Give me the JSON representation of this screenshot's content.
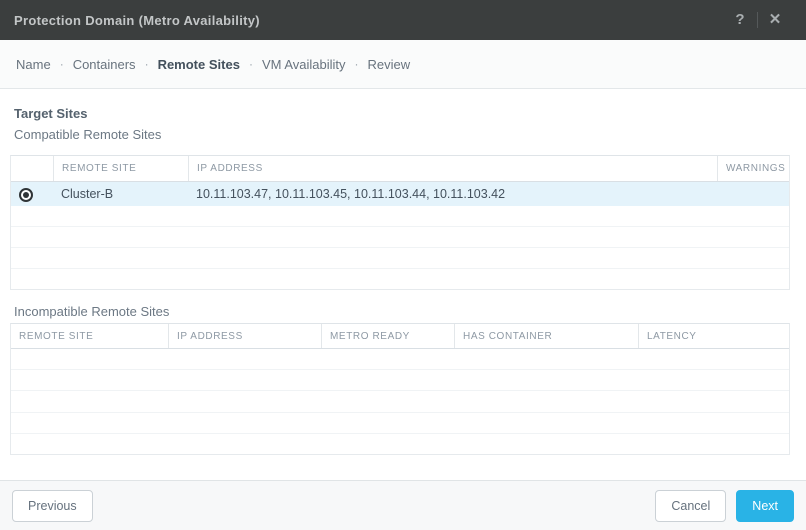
{
  "dialog": {
    "title": "Protection Domain (Metro Availability)"
  },
  "icons": {
    "help": "?",
    "close": "✕"
  },
  "steps": {
    "separator": "·",
    "active_step": "Remote Sites",
    "items": [
      {
        "label": "Name"
      },
      {
        "label": "Containers"
      },
      {
        "label": "Remote Sites"
      },
      {
        "label": "VM Availability"
      },
      {
        "label": "Review"
      }
    ]
  },
  "content": {
    "section_title": "Target Sites",
    "compatible": {
      "label": "Compatible Remote Sites",
      "columns": {
        "remote_site": "REMOTE SITE",
        "ip_address": "IP ADDRESS",
        "warnings": "WARNINGS"
      },
      "selected_row": {
        "remote_site": "Cluster-B",
        "ip_address": "10.11.103.47, 10.11.103.45, 10.11.103.44, 10.11.103.42",
        "warnings": "",
        "selected": true
      }
    },
    "incompatible": {
      "label": "Incompatible Remote Sites",
      "columns": {
        "remote_site": "REMOTE SITE",
        "ip_address": "IP ADDRESS",
        "metro_ready": "METRO READY",
        "has_container": "HAS CONTAINER",
        "latency": "LATENCY"
      },
      "rows": []
    }
  },
  "footer": {
    "previous": "Previous",
    "cancel": "Cancel",
    "next": "Next"
  },
  "colors": {
    "titlebar_bg": "#3b3e3e",
    "accent_blue": "#29b3e6",
    "selected_row_bg": "#e4f3fb"
  }
}
